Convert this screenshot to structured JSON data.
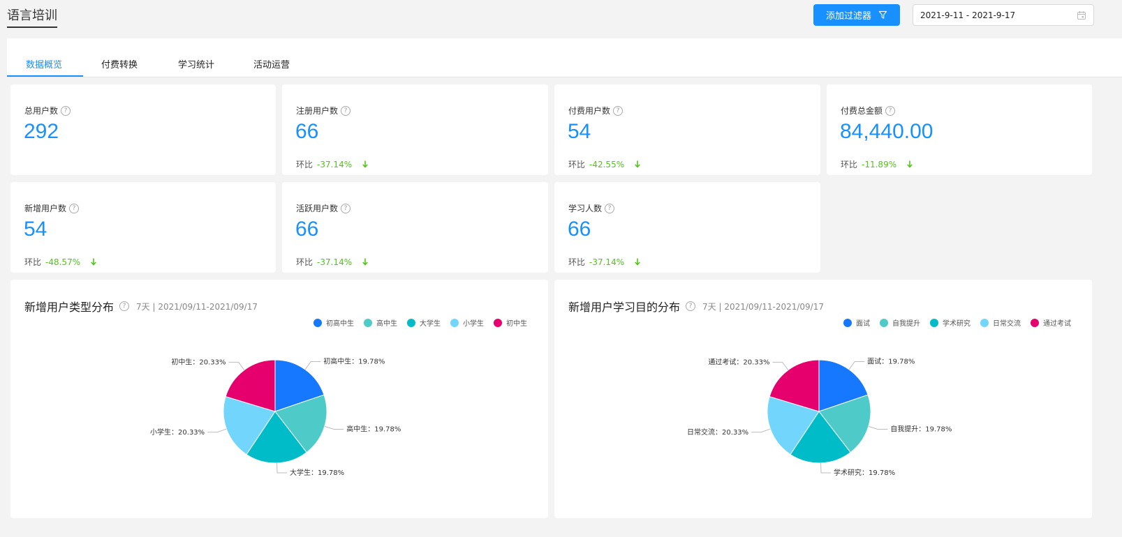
{
  "header": {
    "title": "语言培训",
    "filter_button": "添加过滤器",
    "date_range": "2021-9-11 - 2021-9-17"
  },
  "tabs": [
    {
      "label": "数据概览",
      "active": true
    },
    {
      "label": "付费转换",
      "active": false
    },
    {
      "label": "学习统计",
      "active": false
    },
    {
      "label": "活动运营",
      "active": false
    }
  ],
  "kpis": [
    {
      "label": "总用户数",
      "value": "292",
      "change_label": "",
      "change": ""
    },
    {
      "label": "注册用户数",
      "value": "66",
      "change_label": "环比",
      "change": "-37.14%"
    },
    {
      "label": "付费用户数",
      "value": "54",
      "change_label": "环比",
      "change": "-42.55%"
    },
    {
      "label": "付费总金额",
      "value": "84,440.00",
      "change_label": "环比",
      "change": "-11.89%"
    },
    {
      "label": "新增用户数",
      "value": "54",
      "change_label": "环比",
      "change": "-48.57%"
    },
    {
      "label": "活跃用户数",
      "value": "66",
      "change_label": "环比",
      "change": "-37.14%"
    },
    {
      "label": "学习人数",
      "value": "66",
      "change_label": "环比",
      "change": "-37.14%"
    }
  ],
  "colors": {
    "accent": "#1890ff",
    "down": "#52c41a",
    "series": [
      "#1677ff",
      "#4ecbc8",
      "#00bcc9",
      "#72d5fb",
      "#e5006e"
    ]
  },
  "chart_data": [
    {
      "type": "pie",
      "title": "新增用户类型分布",
      "subtitle": "7天 | 2021/09/11-2021/09/17",
      "legend_position": "top-right",
      "slices": [
        {
          "name": "初高中生",
          "value": 19.78,
          "label": "初高中生：19.78%"
        },
        {
          "name": "高中生",
          "value": 19.78,
          "label": "高中生：19.78%"
        },
        {
          "name": "大学生",
          "value": 19.78,
          "label": "大学生：19.78%"
        },
        {
          "name": "小学生",
          "value": 20.33,
          "label": "小学生：20.33%"
        },
        {
          "name": "初中生",
          "value": 20.33,
          "label": "初中生：20.33%"
        }
      ]
    },
    {
      "type": "pie",
      "title": "新增用户学习目的分布",
      "subtitle": "7天 | 2021/09/11-2021/09/17",
      "legend_position": "top-right",
      "slices": [
        {
          "name": "面试",
          "value": 19.78,
          "label": "面试：19.78%"
        },
        {
          "name": "自我提升",
          "value": 19.78,
          "label": "自我提升：19.78%"
        },
        {
          "name": "学术研究",
          "value": 19.78,
          "label": "学术研究：19.78%"
        },
        {
          "name": "日常交流",
          "value": 20.33,
          "label": "日常交流：20.33%"
        },
        {
          "name": "通过考试",
          "value": 20.33,
          "label": "通过考试：20.33%"
        }
      ]
    }
  ]
}
